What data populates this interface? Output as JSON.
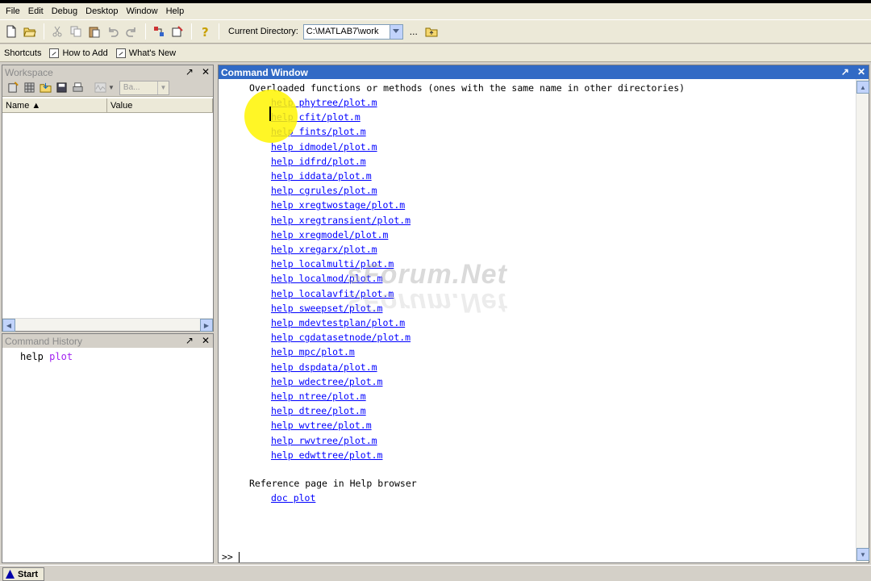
{
  "menu": [
    "File",
    "Edit",
    "Debug",
    "Desktop",
    "Window",
    "Help"
  ],
  "toolbar": {
    "current_dir_label": "Current Directory:",
    "current_dir_value": "C:\\MATLAB7\\work",
    "browse_label": "..."
  },
  "shortcuts": {
    "label": "Shortcuts",
    "how_to_add": "How to Add",
    "whats_new": "What's New"
  },
  "workspace": {
    "title": "Workspace",
    "combo_value": "Ba...",
    "col_name": "Name ▲",
    "col_value": "Value"
  },
  "history": {
    "title": "Command History",
    "entry_cmd": "help",
    "entry_arg": "plot"
  },
  "command_window": {
    "title": "Command Window",
    "header": "Overloaded functions or methods (ones with the same name in other directories)",
    "links": [
      "help phytree/plot.m",
      "help cfit/plot.m",
      "help fints/plot.m",
      "help idmodel/plot.m",
      "help idfrd/plot.m",
      "help iddata/plot.m",
      "help cgrules/plot.m",
      "help xregtwostage/plot.m",
      "help xregtransient/plot.m",
      "help xregmodel/plot.m",
      "help xregarx/plot.m",
      "help localmulti/plot.m",
      "help localmod/plot.m",
      "help localavfit/plot.m",
      "help sweepset/plot.m",
      "help mdevtestplan/plot.m",
      "help cgdatasetnode/plot.m",
      "help mpc/plot.m",
      "help dspdata/plot.m",
      "help wdectree/plot.m",
      "help ntree/plot.m",
      "help dtree/plot.m",
      "help wvtree/plot.m",
      "help rwvtree/plot.m",
      "help edwttree/plot.m"
    ],
    "ref_text": "Reference page in Help browser",
    "doc_link": "doc plot",
    "prompt": ">>"
  },
  "watermark": "sForum.Net",
  "statusbar": {
    "start_label": "Start"
  },
  "colors": {
    "title_active": "#316ac5",
    "link": "#0000ff",
    "keyword": "#a020f0",
    "highlight": "#fff500"
  }
}
